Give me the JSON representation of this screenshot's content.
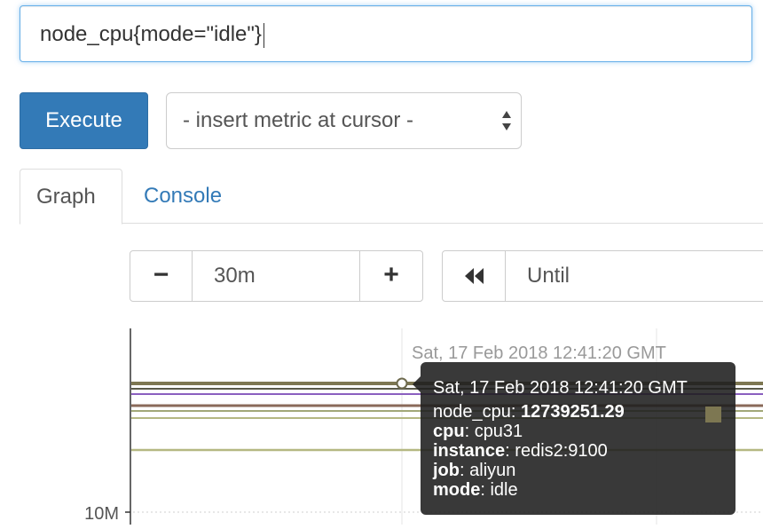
{
  "query": {
    "value": "node_cpu{mode=\"idle\"}"
  },
  "toolbar": {
    "execute_label": "Execute",
    "metric_select_value": "- insert metric at cursor -"
  },
  "tabs": [
    {
      "label": "Graph",
      "active": true
    },
    {
      "label": "Console",
      "active": false
    }
  ],
  "range_controls": {
    "minus_label": "−",
    "range_value": "30m",
    "plus_label": "+",
    "until_placeholder": "Until"
  },
  "graph": {
    "hover_time": "Sat, 17 Feb 2018 12:41:20 GMT",
    "y_tick_label": "10M",
    "series_colors": [
      "#7d7752",
      "#5a5a4a",
      "#8b5fbf",
      "#8a6a5a",
      "#a2a878",
      "#b5b882"
    ]
  },
  "tooltip": {
    "time": "Sat, 17 Feb 2018 12:41:20 GMT",
    "metric_key": "node_cpu",
    "metric_value": "12739251.29",
    "swatch_color": "#7d7752",
    "labels": [
      {
        "key": "cpu",
        "value": "cpu31"
      },
      {
        "key": "instance",
        "value": "redis2:9100"
      },
      {
        "key": "job",
        "value": "aliyun"
      },
      {
        "key": "mode",
        "value": "idle"
      }
    ]
  }
}
